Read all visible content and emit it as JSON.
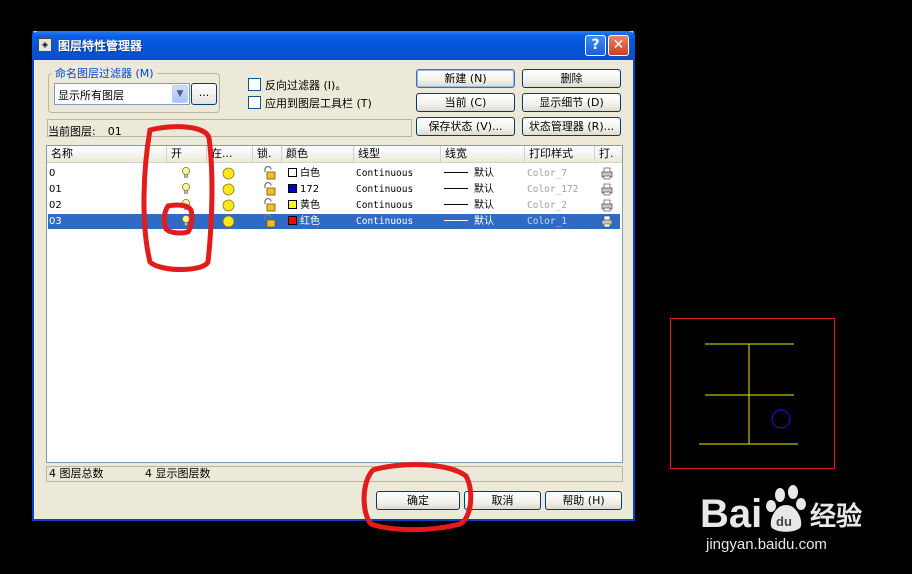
{
  "window": {
    "title": "图层特性管理器",
    "help_label": "?",
    "close_label": "✕"
  },
  "filter": {
    "group_label": "命名图层过滤器 (M)",
    "selected": "显示所有图层",
    "browse_label": "...",
    "invert_label": "反向过滤器 (I)。",
    "apply_toolbar_label": "应用到图层工具栏 (T)"
  },
  "buttons": {
    "new": "新建 (N)",
    "delete": "删除",
    "current": "当前 (C)",
    "show_details": "显示细节 (D)",
    "save_state": "保存状态 (V)...",
    "state_manager": "状态管理器 (R)...",
    "ok": "确定",
    "cancel": "取消",
    "help": "帮助 (H)"
  },
  "current_layer": {
    "label": "当前图层:",
    "value": "01"
  },
  "columns": [
    "名称",
    "开",
    "在...",
    "锁.",
    "颜色",
    "线型",
    "线宽",
    "打印样式",
    "打."
  ],
  "layers": [
    {
      "name": "0",
      "color_name": "白色",
      "color_hex": "#ffffff",
      "linetype": "Continuous",
      "lineweight": "默认",
      "plot_style": "Color_7",
      "selected": false
    },
    {
      "name": "01",
      "color_name": "172",
      "color_hex": "#0000cc",
      "linetype": "Continuous",
      "lineweight": "默认",
      "plot_style": "Color_172",
      "selected": false
    },
    {
      "name": "02",
      "color_name": "黄色",
      "color_hex": "#ffff00",
      "linetype": "Continuous",
      "lineweight": "默认",
      "plot_style": "Color_2",
      "selected": false
    },
    {
      "name": "03",
      "color_name": "红色",
      "color_hex": "#ff0000",
      "linetype": "Continuous",
      "lineweight": "默认",
      "plot_style": "Color_1",
      "selected": true
    }
  ],
  "status": {
    "total": "4 图层总数",
    "shown": "4 显示图层数"
  },
  "watermark": {
    "url": "jingyan.baidu.com"
  },
  "colors": {
    "titlebar": "#0356d6",
    "dialog_bg": "#ece9d8",
    "selection": "#316ac5",
    "annotation": "#e31b1b",
    "preview_lines": "#e8e800",
    "preview_circle": "#1a1aa8"
  }
}
